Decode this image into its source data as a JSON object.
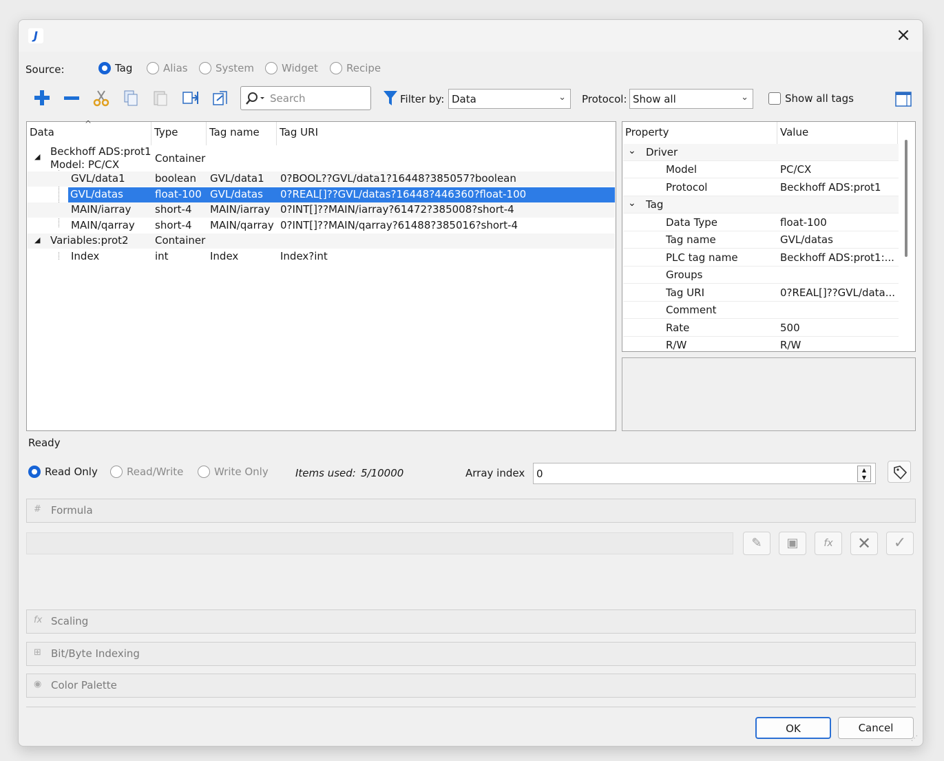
{
  "window": {
    "icon_text": "J"
  },
  "source": {
    "label": "Source:",
    "options": [
      "Tag",
      "Alias",
      "System",
      "Widget",
      "Recipe"
    ],
    "selected": "Tag"
  },
  "toolbar": {
    "search_placeholder": "Search",
    "filter_label": "Filter by:",
    "filter_value": "Data",
    "protocol_label": "Protocol:",
    "protocol_value": "Show all",
    "show_all_tags_label": "Show all tags",
    "show_all_tags_checked": false
  },
  "tree": {
    "columns": [
      "Data",
      "Type",
      "Tag name",
      "Tag URI"
    ],
    "rows": [
      {
        "data": "Beckhoff ADS:prot1",
        "data2": "Model: PC/CX",
        "type": "Container",
        "tagname": "",
        "uri": ""
      },
      {
        "data": "GVL/data1",
        "type": "boolean",
        "tagname": "GVL/data1",
        "uri": "0?BOOL??GVL/data1?16448?385057?boolean"
      },
      {
        "data": "GVL/datas",
        "type": "float-100",
        "tagname": "GVL/datas",
        "uri": "0?REAL[]??GVL/datas?16448?446360?float-100"
      },
      {
        "data": "MAIN/iarray",
        "type": "short-4",
        "tagname": "MAIN/iarray",
        "uri": "0?INT[]??MAIN/iarray?61472?385008?short-4"
      },
      {
        "data": "MAIN/qarray",
        "type": "short-4",
        "tagname": "MAIN/qarray",
        "uri": "0?INT[]??MAIN/qarray?61488?385016?short-4"
      },
      {
        "data": "Variables:prot2",
        "type": "Container",
        "tagname": "",
        "uri": ""
      },
      {
        "data": "Index",
        "type": "int",
        "tagname": "Index",
        "uri": "Index?int"
      }
    ]
  },
  "properties": {
    "columns": [
      "Property",
      "Value"
    ],
    "groups": [
      {
        "name": "Driver",
        "items": [
          {
            "k": "Model",
            "v": "PC/CX"
          },
          {
            "k": "Protocol",
            "v": "Beckhoff ADS:prot1"
          }
        ]
      },
      {
        "name": "Tag",
        "items": [
          {
            "k": "Data Type",
            "v": "float-100"
          },
          {
            "k": "Tag name",
            "v": "GVL/datas"
          },
          {
            "k": "PLC tag name",
            "v": "Beckhoff ADS:prot1:..."
          },
          {
            "k": "Groups",
            "v": ""
          },
          {
            "k": "Tag URI",
            "v": "0?REAL[]??GVL/data..."
          },
          {
            "k": "Comment",
            "v": ""
          },
          {
            "k": "Rate",
            "v": "500"
          },
          {
            "k": "R/W",
            "v": "R/W"
          }
        ]
      }
    ]
  },
  "status": "Ready",
  "access": {
    "options": [
      "Read Only",
      "Read/Write",
      "Write Only"
    ],
    "selected": "Read Only",
    "items_used_label": "Items used:",
    "items_used_value": "5/10000",
    "array_index_label": "Array index",
    "array_index_value": "0"
  },
  "sections": [
    "Formula",
    "Scaling",
    "Bit/Byte Indexing",
    "Color Palette"
  ],
  "buttons": {
    "ok": "OK",
    "cancel": "Cancel"
  }
}
